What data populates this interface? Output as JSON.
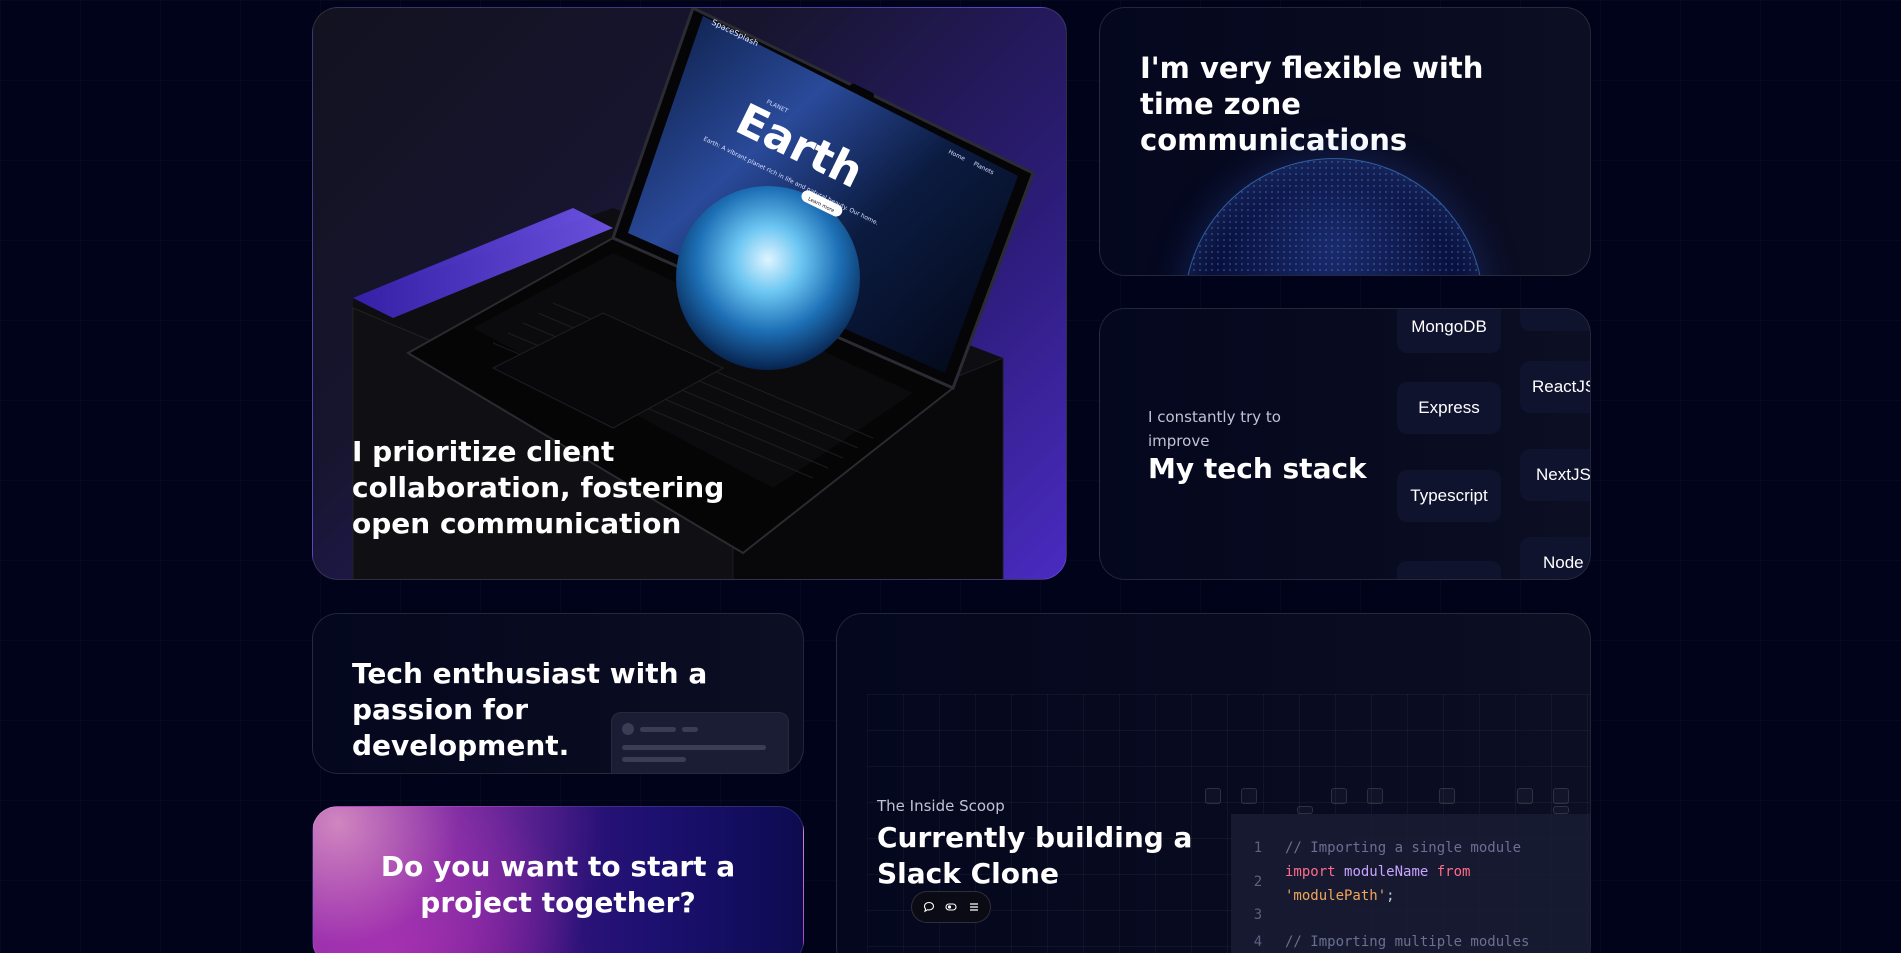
{
  "cards": {
    "collab": {
      "title": "I prioritize client collaboration, fostering open communication",
      "laptop_screen": {
        "brand": "SpaceSplash",
        "small_label": "PLANET",
        "headline": "Earth",
        "tagline": "Earth: A vibrant planet rich in life and natural beauty. Our home.",
        "nav": [
          "Home",
          "Planets"
        ],
        "cta": "Learn more"
      }
    },
    "timezone": {
      "title": "I'm very flexible with time zone communications"
    },
    "stack": {
      "subtitle": "I constantly try to improve",
      "title": "My tech stack",
      "left_column": [
        "MongoDB",
        "Express",
        "Typescript"
      ],
      "right_column": [
        "ReactJS",
        "NextJS",
        "Node"
      ]
    },
    "enthusiast": {
      "title": "Tech enthusiast with a passion for development."
    },
    "project": {
      "title": "Do you want to start a project together?"
    },
    "slack": {
      "subtitle": "The Inside Scoop",
      "title": "Currently building a Slack Clone",
      "code": {
        "line1_num": "1",
        "line1": "// Importing a single module",
        "line2_num": "2",
        "line2_kw1": "import",
        "line2_id": "moduleName",
        "line2_kw2": "from",
        "line2b_str": "'modulePath'",
        "line2b_end": ";",
        "line3_num": "3",
        "line4_num": "4",
        "line4": "// Importing multiple modules"
      },
      "toolbar_icons": [
        "chat-icon",
        "toggle-icon",
        "menu-icon"
      ]
    }
  },
  "colors": {
    "background": "#000319",
    "card_bg": "#0c0e23",
    "accent_purple": "#4a2bc2",
    "pill_bg": "#10132e"
  }
}
